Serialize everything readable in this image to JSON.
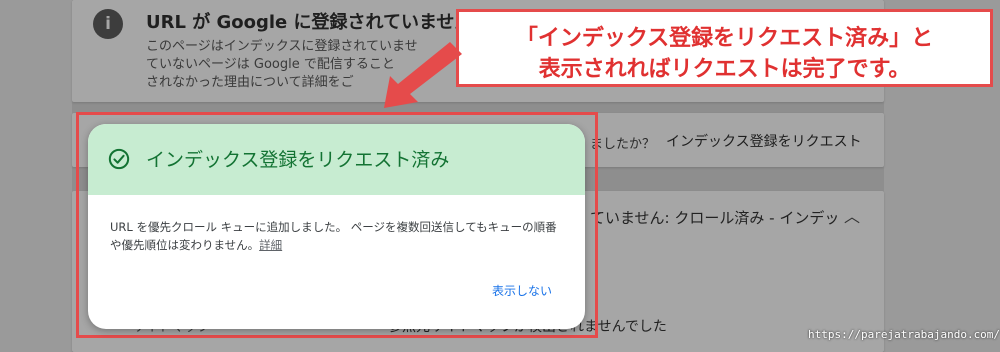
{
  "background": {
    "status_card": {
      "title": "URL が Google に登録されていません",
      "description": "このページはインデックスに登録されていませ\nていないページは Google で配信すること\nされなかった理由について詳細をご"
    },
    "live_test": {
      "prompt": "ましたか？",
      "request_link": "インデックス登録をリクエスト"
    },
    "coverage": {
      "text": "ていません: クロール済み - インデッ",
      "sitemap_label": "サイトマップ",
      "sitemap_value": "参照元サイトマップが検出されませんでした"
    }
  },
  "dialog": {
    "title": "インデックス登録をリクエスト済み",
    "body": "URL を優先クロール キューに追加しました。 ページを複数回送信してもキューの順番や優先順位は変わりません。",
    "details_link": "詳細",
    "dismiss_label": "表示しない"
  },
  "callout": {
    "line1": "「インデックス登録をリクエスト済み」と",
    "line2": "表示されればリクエストは完了です。"
  },
  "watermark": "https://parejatrabajando.com/",
  "colors": {
    "annotation_red": "#e54b4b",
    "success_green": "#137333",
    "success_bg": "#c7ecd1",
    "link_blue": "#1a73e8"
  }
}
